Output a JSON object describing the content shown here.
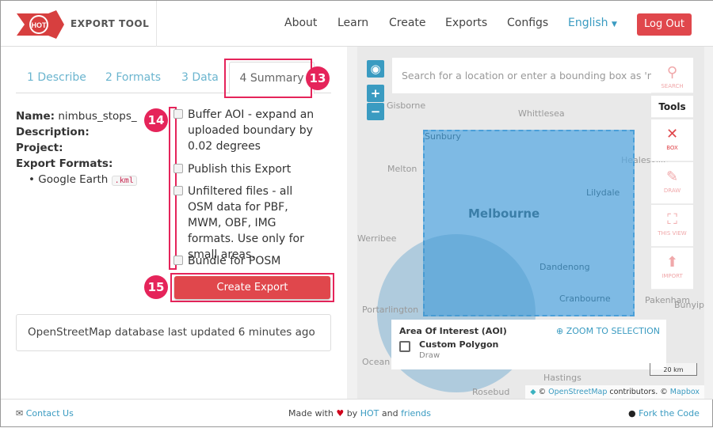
{
  "header": {
    "logo_text": "HOT",
    "brand": "EXPORT TOOL",
    "nav": [
      "About",
      "Learn",
      "Create",
      "Exports",
      "Configs"
    ],
    "language": "English",
    "logout": "Log Out"
  },
  "tabs": [
    "1 Describe",
    "2 Formats",
    "3 Data",
    "4 Summary"
  ],
  "annotations": [
    "13",
    "14",
    "15"
  ],
  "summary": {
    "name_label": "Name:",
    "name_value": "nimbus_stops_",
    "description_label": "Description:",
    "project_label": "Project:",
    "formats_label": "Export Formats:",
    "formats": [
      {
        "name": "Google Earth",
        "ext": ".kml"
      }
    ]
  },
  "options": [
    "Buffer AOI - expand an uploaded boundary by 0.02 degrees",
    "Publish this Export",
    "Unfiltered files - all OSM data for PBF, MWM, OBF, IMG formats. Use only for small areas.",
    "Bundle for POSM"
  ],
  "create_button": "Create Export",
  "status": "OpenStreetMap database last updated 6 minutes ago",
  "map": {
    "search_placeholder": "Search for a location or enter a bounding box as 'min",
    "search_label": "SEARCH",
    "tools_title": "Tools",
    "tools": [
      "BOX",
      "DRAW",
      "THIS VIEW",
      "IMPORT"
    ],
    "zoom_in": "+",
    "zoom_out": "−",
    "places": [
      "Gisborne",
      "Whittlesea",
      "Sunbury",
      "Melton",
      "Healesville",
      "Lilydale",
      "Werribee",
      "Dandenong",
      "Pakenham",
      "Cranbourne",
      "Portarlington",
      "Bunyip",
      "Ocean Grove",
      "Hastings",
      "Rosebud"
    ],
    "city": "Melbourne",
    "aoi_title": "Area Of Interest (AOI)",
    "zoom_selection": "ZOOM TO SELECTION",
    "aoi_item": "Custom Polygon",
    "aoi_sub": "Draw",
    "scale": "20 km",
    "attribution": {
      "copy1": "©",
      "osm": "OpenStreetMap",
      "contrib": "contributors. ©",
      "mapbox": "Mapbox"
    }
  },
  "footer": {
    "contact": "Contact Us",
    "made_with": "Made with",
    "by": "by",
    "hot": "HOT",
    "and": "and",
    "friends": "friends",
    "fork": "Fork the Code"
  }
}
